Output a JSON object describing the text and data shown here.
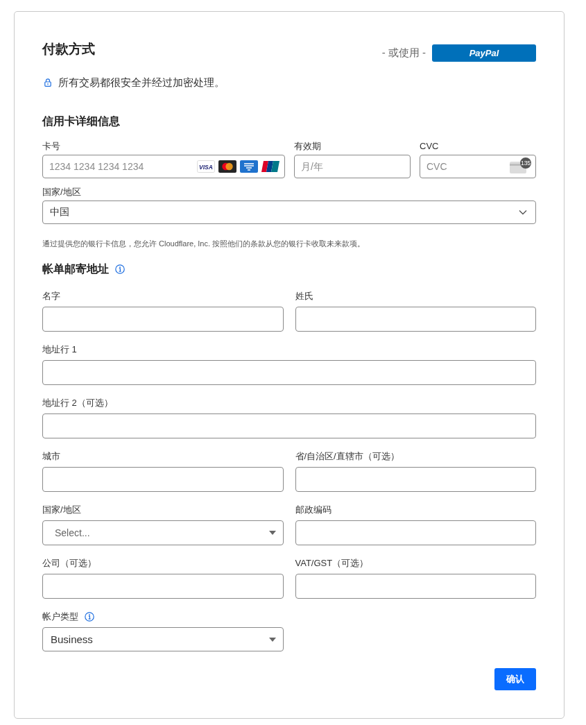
{
  "payment": {
    "title": "付款方式",
    "alternative_label": "- 或使用 -",
    "paypal_button": "PayPal",
    "security_note": "所有交易都很安全并经过加密处理。"
  },
  "card_details": {
    "title": "信用卡详细信息",
    "fields": [
      {
        "kind": "card_number",
        "label": "卡号",
        "placeholder": "1234 1234 1234 1234",
        "brands": [
          {
            "kind": "visa",
            "text": "VISA"
          },
          {
            "kind": "mastercard"
          },
          {
            "kind": "amex"
          },
          {
            "kind": "unionpay"
          }
        ]
      },
      {
        "kind": "expiry",
        "label": "有效期",
        "placeholder": "月/年"
      },
      {
        "kind": "cvc",
        "label": "CVC",
        "placeholder": "CVC",
        "icon_text": "135"
      }
    ],
    "country": {
      "label": "国家/地区",
      "value": "中国"
    },
    "authorization_note": "通过提供您的银行卡信息，您允许 Cloudflare, Inc. 按照他们的条款从您的银行卡收取未来款项。"
  },
  "billing_address": {
    "title": "帐单邮寄地址",
    "info": true,
    "rows": [
      {
        "kind": "pair",
        "fields": [
          {
            "kind": "text",
            "label": "名字",
            "info": false
          },
          {
            "kind": "text",
            "label": "姓氏",
            "info": false
          }
        ]
      },
      {
        "kind": "wide",
        "fields": [
          {
            "kind": "text",
            "label": "地址行 1",
            "info": false
          }
        ]
      },
      {
        "kind": "wide",
        "fields": [
          {
            "kind": "text",
            "label": "地址行 2（可选）",
            "info": false
          }
        ]
      },
      {
        "kind": "pair",
        "fields": [
          {
            "kind": "text",
            "label": "城市",
            "info": false
          },
          {
            "kind": "text",
            "label": "省/自治区/直辖市（可选）",
            "info": false
          }
        ]
      },
      {
        "kind": "pair",
        "fields": [
          {
            "kind": "select",
            "label": "国家/地区",
            "placeholder": "Select...",
            "info": false
          },
          {
            "kind": "text",
            "label": "邮政编码",
            "info": false
          }
        ]
      },
      {
        "kind": "pair",
        "fields": [
          {
            "kind": "text",
            "label": "公司（可选）",
            "info": false
          },
          {
            "kind": "text",
            "label": "VAT/GST（可选）",
            "info": false
          }
        ]
      },
      {
        "kind": "pair",
        "fields": [
          {
            "kind": "select",
            "label": "帐户类型",
            "value": "Business",
            "info": true
          }
        ]
      }
    ]
  },
  "buttons": [
    {
      "label": "确认"
    }
  ]
}
